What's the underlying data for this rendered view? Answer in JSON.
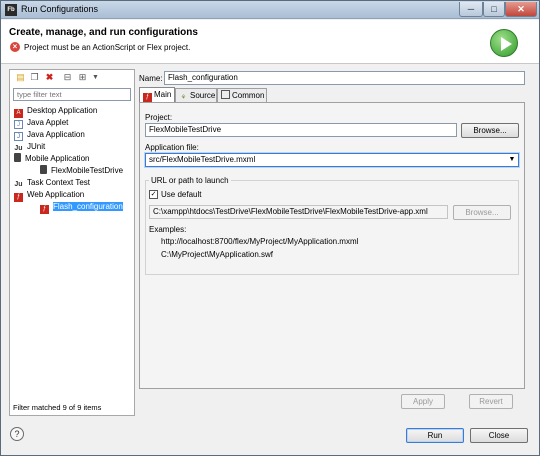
{
  "window": {
    "title": "Run Configurations",
    "app_badge": "Fb",
    "minimize": "─",
    "maximize": "□",
    "close": "✕"
  },
  "header": {
    "title": "Create, manage, and run configurations",
    "message": "Project must be an ActionScript or Flex project."
  },
  "left_panel": {
    "filter_placeholder": "type filter text",
    "tree": [
      {
        "label": "Desktop Application",
        "icon": "flex-desktop-icon",
        "level": 0
      },
      {
        "label": "Java Applet",
        "icon": "java-applet-icon",
        "level": 0
      },
      {
        "label": "Java Application",
        "icon": "java-app-icon",
        "level": 0
      },
      {
        "label": "JUnit",
        "icon": "junit-icon",
        "level": 0
      },
      {
        "label": "Mobile Application",
        "icon": "mobile-icon",
        "level": 0
      },
      {
        "label": "FlexMobileTestDrive",
        "icon": "mobile-icon",
        "level": 1
      },
      {
        "label": "Task Context Test",
        "icon": "task-icon",
        "level": 0
      },
      {
        "label": "Web Application",
        "icon": "flex-web-icon",
        "level": 0
      },
      {
        "label": "Flash_configuration",
        "icon": "flex-web-icon",
        "level": 1,
        "selected": true
      }
    ],
    "status": "Filter matched 9 of 9 items"
  },
  "config": {
    "name_label": "Name:",
    "name_value": "Flash_configuration",
    "tabs": [
      {
        "label": "Main",
        "active": true
      },
      {
        "label": "Source"
      },
      {
        "label": "Common"
      }
    ],
    "project_label": "Project:",
    "project_value": "FlexMobileTestDrive",
    "browse_label": "Browse...",
    "app_file_label": "Application file:",
    "app_file_value": "src/FlexMobileTestDrive.mxml",
    "url_group_title": "URL or path to launch",
    "use_default_label": "Use default",
    "use_default_checked": true,
    "url_value": "C:\\xampp\\htdocs\\TestDrive\\FlexMobileTestDrive\\FlexMobileTestDrive-app.xml",
    "url_browse_label": "Browse...",
    "examples_label": "Examples:",
    "example_1": "http://localhost:8700/flex/MyProject/MyApplication.mxml",
    "example_2": "C:\\MyProject\\MyApplication.swf",
    "apply_label": "Apply",
    "revert_label": "Revert"
  },
  "footer": {
    "help": "?",
    "run_label": "Run",
    "close_label": "Close"
  }
}
